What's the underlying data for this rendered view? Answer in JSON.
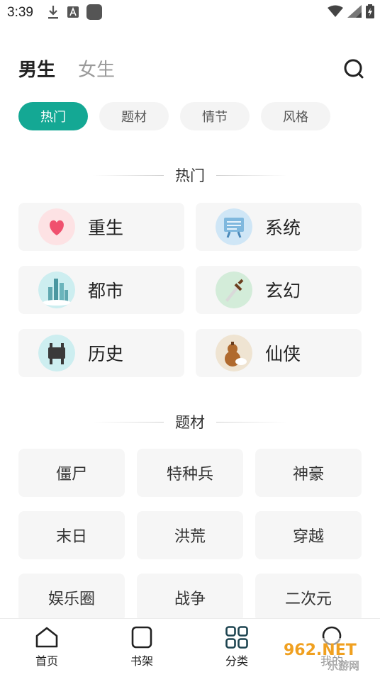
{
  "status_bar": {
    "time": "3:39",
    "left_icons": [
      "download-icon",
      "a-letter-icon",
      "app-square-icon"
    ],
    "right_icons": [
      "wifi-icon",
      "signal-icon",
      "battery-icon"
    ]
  },
  "top_nav": {
    "tabs": [
      {
        "label": "男生",
        "active": true
      },
      {
        "label": "女生",
        "active": false
      }
    ],
    "search_icon": "search-icon"
  },
  "chips": [
    {
      "label": "热门",
      "active": true
    },
    {
      "label": "题材",
      "active": false
    },
    {
      "label": "情节",
      "active": false
    },
    {
      "label": "风格",
      "active": false
    }
  ],
  "sections": {
    "hot_title": "热门",
    "topic_title": "题材"
  },
  "hot_items": [
    {
      "label": "重生",
      "icon": "heart-icon"
    },
    {
      "label": "系统",
      "icon": "screen-icon"
    },
    {
      "label": "都市",
      "icon": "city-icon"
    },
    {
      "label": "玄幻",
      "icon": "sword-icon"
    },
    {
      "label": "历史",
      "icon": "bronze-vessel-icon"
    },
    {
      "label": "仙侠",
      "icon": "gourd-icon"
    }
  ],
  "topic_items": [
    "僵尸",
    "特种兵",
    "神豪",
    "末日",
    "洪荒",
    "穿越",
    "娱乐圈",
    "战争",
    "二次元"
  ],
  "bottom_nav": [
    {
      "label": "首页",
      "icon": "home-icon"
    },
    {
      "label": "书架",
      "icon": "bookshelf-icon"
    },
    {
      "label": "分类",
      "icon": "category-icon"
    },
    {
      "label": "我的",
      "icon": "profile-icon"
    }
  ],
  "watermark": {
    "text_top": "962.NET",
    "text_bottom": "乐游网"
  },
  "colors": {
    "accent": "#14a894",
    "card_bg": "#f6f6f6",
    "chip_bg": "#f4f4f4"
  }
}
